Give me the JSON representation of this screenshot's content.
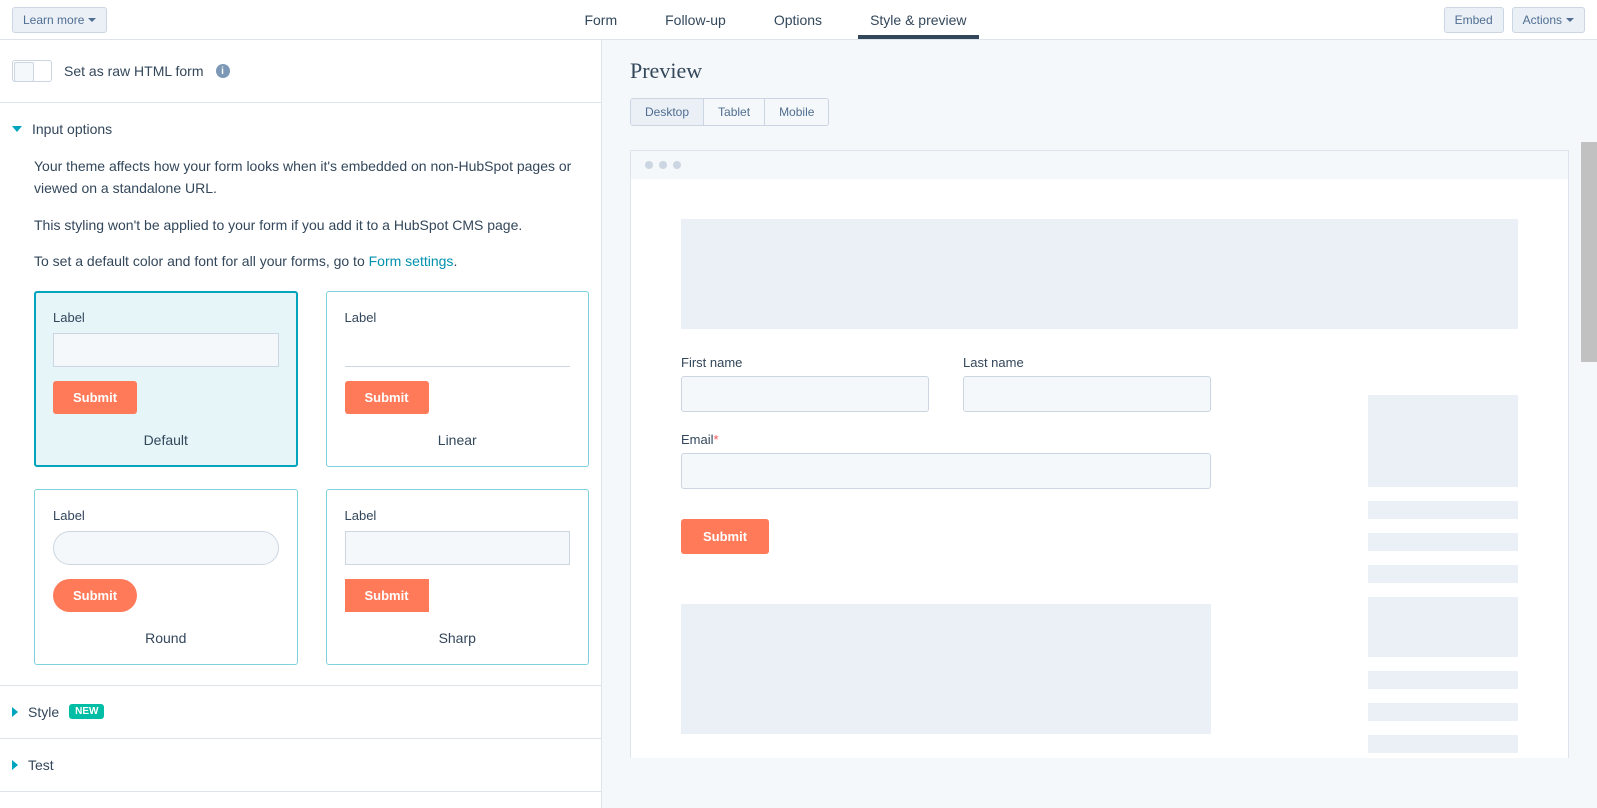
{
  "topbar": {
    "learn_more": "Learn more",
    "tabs": {
      "form": "Form",
      "followup": "Follow-up",
      "options": "Options",
      "style": "Style & preview"
    },
    "embed": "Embed",
    "actions": "Actions"
  },
  "left": {
    "raw_html_label": "Set as raw HTML form",
    "section_input": "Input options",
    "desc1": "Your theme affects how your form looks when it's embedded on non-HubSpot pages or viewed on a standalone URL.",
    "desc2": "This styling won't be applied to your form if you add it to a HubSpot CMS page.",
    "desc3_pre": "To set a default color and font for all your forms, go to ",
    "desc3_link": "Form settings",
    "theme_label": "Label",
    "theme_submit": "Submit",
    "themes": {
      "default": "Default",
      "linear": "Linear",
      "round": "Round",
      "sharp": "Sharp"
    },
    "section_style": "Style",
    "badge_new": "NEW",
    "section_test": "Test"
  },
  "preview": {
    "title": "Preview",
    "devices": {
      "desktop": "Desktop",
      "tablet": "Tablet",
      "mobile": "Mobile"
    },
    "fields": {
      "first_name": "First name",
      "last_name": "Last name",
      "email": "Email"
    },
    "submit": "Submit"
  }
}
